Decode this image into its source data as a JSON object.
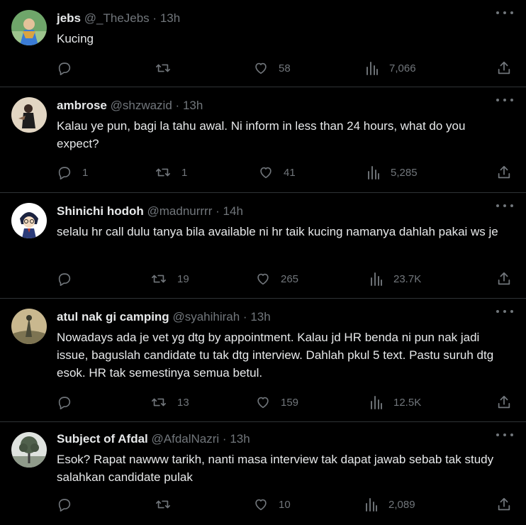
{
  "tweets": [
    {
      "name": "jebs",
      "handle": "@_TheJebs",
      "time": "13h",
      "text": "Kucing",
      "replies": "",
      "retweets": "",
      "likes": "58",
      "views": "7,066",
      "avatar_color": "#3a7bd5"
    },
    {
      "name": "ambrose",
      "handle": "@shzwazid",
      "time": "13h",
      "text": "Kalau ye pun, bagi la tahu awal. Ni inform in less than 24 hours, what do you expect?",
      "replies": "1",
      "retweets": "1",
      "likes": "41",
      "views": "5,285",
      "avatar_color": "#d9cbb6"
    },
    {
      "name": "Shinichi hodoh",
      "handle": "@madnurrrr",
      "time": "14h",
      "text": "selalu hr call dulu tanya bila available ni hr taik kucing namanya dahlah pakai ws je",
      "replies": "",
      "retweets": "19",
      "likes": "265",
      "views": "23.7K",
      "avatar_color": "#ffffff"
    },
    {
      "name": "atul nak gi camping",
      "handle": "@syahihirah",
      "time": "13h",
      "text": "Nowadays ada je vet yg dtg by appointment. Kalau jd HR benda ni pun nak jadi issue, baguslah candidate tu tak dtg interview. Dahlah pkul 5 text. Pastu suruh dtg esok. HR tak semestinya semua betul.",
      "replies": "",
      "retweets": "13",
      "likes": "159",
      "views": "12.5K",
      "avatar_color": "#8a7a55"
    },
    {
      "name": "Subject of Afdal",
      "handle": "@AfdalNazri",
      "time": "13h",
      "text": "Esok? Rapat nawww tarikh, nanti masa interview tak dapat jawab sebab tak study salahkan candidate pulak",
      "replies": "",
      "retweets": "",
      "likes": "10",
      "views": "2,089",
      "avatar_color": "#6f7a6a"
    }
  ],
  "separator": "·",
  "colors": {
    "background": "#000000",
    "text": "#e7e9ea",
    "muted": "#71767b",
    "border": "#2f3336"
  },
  "icons": [
    "reply-icon",
    "retweet-icon",
    "like-icon",
    "views-icon",
    "share-icon",
    "more-icon"
  ]
}
